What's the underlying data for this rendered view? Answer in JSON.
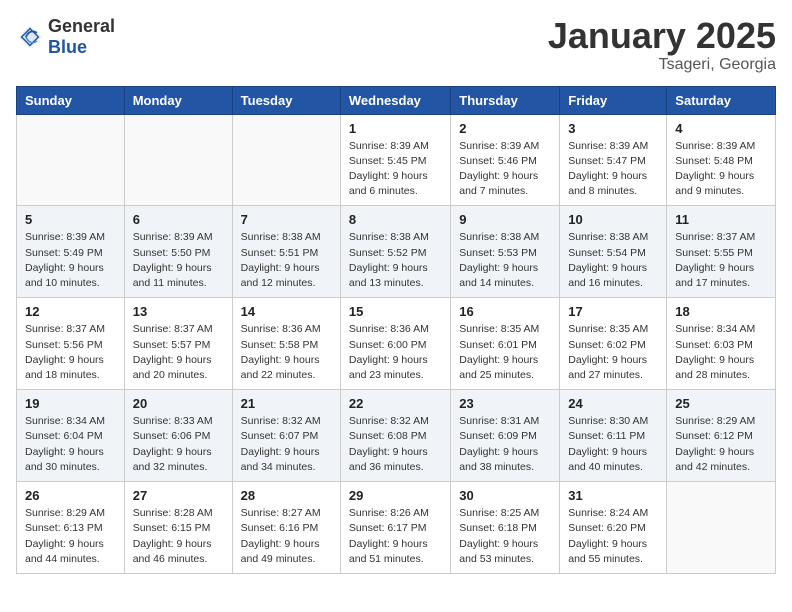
{
  "header": {
    "logo_general": "General",
    "logo_blue": "Blue",
    "title": "January 2025",
    "location": "Tsageri, Georgia"
  },
  "weekdays": [
    "Sunday",
    "Monday",
    "Tuesday",
    "Wednesday",
    "Thursday",
    "Friday",
    "Saturday"
  ],
  "weeks": [
    [
      {
        "day": "",
        "info": ""
      },
      {
        "day": "",
        "info": ""
      },
      {
        "day": "",
        "info": ""
      },
      {
        "day": "1",
        "info": "Sunrise: 8:39 AM\nSunset: 5:45 PM\nDaylight: 9 hours\nand 6 minutes."
      },
      {
        "day": "2",
        "info": "Sunrise: 8:39 AM\nSunset: 5:46 PM\nDaylight: 9 hours\nand 7 minutes."
      },
      {
        "day": "3",
        "info": "Sunrise: 8:39 AM\nSunset: 5:47 PM\nDaylight: 9 hours\nand 8 minutes."
      },
      {
        "day": "4",
        "info": "Sunrise: 8:39 AM\nSunset: 5:48 PM\nDaylight: 9 hours\nand 9 minutes."
      }
    ],
    [
      {
        "day": "5",
        "info": "Sunrise: 8:39 AM\nSunset: 5:49 PM\nDaylight: 9 hours\nand 10 minutes."
      },
      {
        "day": "6",
        "info": "Sunrise: 8:39 AM\nSunset: 5:50 PM\nDaylight: 9 hours\nand 11 minutes."
      },
      {
        "day": "7",
        "info": "Sunrise: 8:38 AM\nSunset: 5:51 PM\nDaylight: 9 hours\nand 12 minutes."
      },
      {
        "day": "8",
        "info": "Sunrise: 8:38 AM\nSunset: 5:52 PM\nDaylight: 9 hours\nand 13 minutes."
      },
      {
        "day": "9",
        "info": "Sunrise: 8:38 AM\nSunset: 5:53 PM\nDaylight: 9 hours\nand 14 minutes."
      },
      {
        "day": "10",
        "info": "Sunrise: 8:38 AM\nSunset: 5:54 PM\nDaylight: 9 hours\nand 16 minutes."
      },
      {
        "day": "11",
        "info": "Sunrise: 8:37 AM\nSunset: 5:55 PM\nDaylight: 9 hours\nand 17 minutes."
      }
    ],
    [
      {
        "day": "12",
        "info": "Sunrise: 8:37 AM\nSunset: 5:56 PM\nDaylight: 9 hours\nand 18 minutes."
      },
      {
        "day": "13",
        "info": "Sunrise: 8:37 AM\nSunset: 5:57 PM\nDaylight: 9 hours\nand 20 minutes."
      },
      {
        "day": "14",
        "info": "Sunrise: 8:36 AM\nSunset: 5:58 PM\nDaylight: 9 hours\nand 22 minutes."
      },
      {
        "day": "15",
        "info": "Sunrise: 8:36 AM\nSunset: 6:00 PM\nDaylight: 9 hours\nand 23 minutes."
      },
      {
        "day": "16",
        "info": "Sunrise: 8:35 AM\nSunset: 6:01 PM\nDaylight: 9 hours\nand 25 minutes."
      },
      {
        "day": "17",
        "info": "Sunrise: 8:35 AM\nSunset: 6:02 PM\nDaylight: 9 hours\nand 27 minutes."
      },
      {
        "day": "18",
        "info": "Sunrise: 8:34 AM\nSunset: 6:03 PM\nDaylight: 9 hours\nand 28 minutes."
      }
    ],
    [
      {
        "day": "19",
        "info": "Sunrise: 8:34 AM\nSunset: 6:04 PM\nDaylight: 9 hours\nand 30 minutes."
      },
      {
        "day": "20",
        "info": "Sunrise: 8:33 AM\nSunset: 6:06 PM\nDaylight: 9 hours\nand 32 minutes."
      },
      {
        "day": "21",
        "info": "Sunrise: 8:32 AM\nSunset: 6:07 PM\nDaylight: 9 hours\nand 34 minutes."
      },
      {
        "day": "22",
        "info": "Sunrise: 8:32 AM\nSunset: 6:08 PM\nDaylight: 9 hours\nand 36 minutes."
      },
      {
        "day": "23",
        "info": "Sunrise: 8:31 AM\nSunset: 6:09 PM\nDaylight: 9 hours\nand 38 minutes."
      },
      {
        "day": "24",
        "info": "Sunrise: 8:30 AM\nSunset: 6:11 PM\nDaylight: 9 hours\nand 40 minutes."
      },
      {
        "day": "25",
        "info": "Sunrise: 8:29 AM\nSunset: 6:12 PM\nDaylight: 9 hours\nand 42 minutes."
      }
    ],
    [
      {
        "day": "26",
        "info": "Sunrise: 8:29 AM\nSunset: 6:13 PM\nDaylight: 9 hours\nand 44 minutes."
      },
      {
        "day": "27",
        "info": "Sunrise: 8:28 AM\nSunset: 6:15 PM\nDaylight: 9 hours\nand 46 minutes."
      },
      {
        "day": "28",
        "info": "Sunrise: 8:27 AM\nSunset: 6:16 PM\nDaylight: 9 hours\nand 49 minutes."
      },
      {
        "day": "29",
        "info": "Sunrise: 8:26 AM\nSunset: 6:17 PM\nDaylight: 9 hours\nand 51 minutes."
      },
      {
        "day": "30",
        "info": "Sunrise: 8:25 AM\nSunset: 6:18 PM\nDaylight: 9 hours\nand 53 minutes."
      },
      {
        "day": "31",
        "info": "Sunrise: 8:24 AM\nSunset: 6:20 PM\nDaylight: 9 hours\nand 55 minutes."
      },
      {
        "day": "",
        "info": ""
      }
    ]
  ]
}
